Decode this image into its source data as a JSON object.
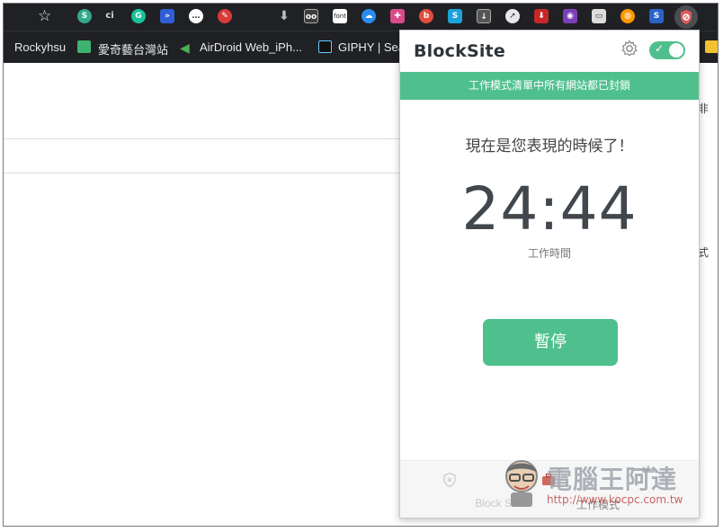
{
  "browser": {
    "bookmarks": [
      {
        "label": "Rockyhsu"
      },
      {
        "label": "愛奇藝台灣站"
      },
      {
        "label": "AirDroid Web_iPh..."
      },
      {
        "label": "GIPHY | Sea"
      }
    ],
    "extension_texts": {
      "ci": "ci",
      "font": "font"
    }
  },
  "page": {
    "peek_text_1": "非",
    "peek_text_2": "式"
  },
  "popup": {
    "logo": "BlockSite",
    "toggle_on": true,
    "banner": "工作模式清單中所有網站都已封鎖",
    "headline": "現在是您表現的時候了！",
    "timer": "24:44",
    "timer_label": "工作時間",
    "pause_button": "暫停",
    "footer_tabs": [
      {
        "label": "Block Site",
        "icon": "shield-x-icon"
      },
      {
        "label": "工作模式",
        "icon": "briefcase-icon"
      },
      {
        "label": "",
        "icon": "crown-icon"
      }
    ],
    "accent_color": "#4fc08d"
  },
  "watermark": {
    "title": "電腦王阿達",
    "url": "http://www.kocpc.com.tw"
  }
}
